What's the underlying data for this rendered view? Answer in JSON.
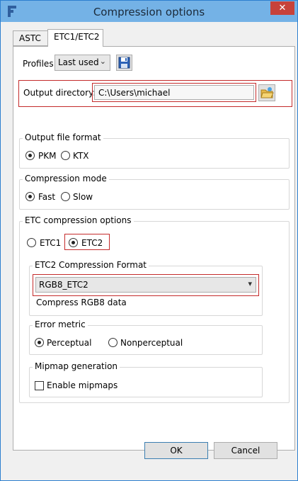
{
  "window": {
    "title": "Compression options",
    "close_glyph": "✕"
  },
  "tabs": [
    {
      "label": "ASTC"
    },
    {
      "label": "ETC1/ETC2"
    }
  ],
  "profiles": {
    "label": "Profiles",
    "selected": "Last used",
    "save_icon": "floppy-disk-icon"
  },
  "output": {
    "label": "Output directory:",
    "value": "C:\\Users\\michael",
    "browse_icon": "folder-open-icon"
  },
  "file_format": {
    "title": "Output file format",
    "options": [
      {
        "label": "PKM",
        "selected": true
      },
      {
        "label": "KTX",
        "selected": false
      }
    ]
  },
  "compression_mode": {
    "title": "Compression mode",
    "options": [
      {
        "label": "Fast",
        "selected": true
      },
      {
        "label": "Slow",
        "selected": false
      }
    ]
  },
  "etc_options": {
    "title": "ETC compression options",
    "codecs": [
      {
        "label": "ETC1",
        "selected": false
      },
      {
        "label": "ETC2",
        "selected": true
      }
    ],
    "etc2_format": {
      "title": "ETC2 Compression Format",
      "selected": "RGB8_ETC2",
      "description": "Compress RGB8 data"
    },
    "error_metric": {
      "title": "Error metric",
      "options": [
        {
          "label": "Perceptual",
          "selected": true
        },
        {
          "label": "Nonperceptual",
          "selected": false
        }
      ]
    },
    "mipmap": {
      "title": "Mipmap generation",
      "checkbox_label": "Enable mipmaps",
      "checked": false
    }
  },
  "buttons": {
    "ok": "OK",
    "cancel": "Cancel"
  },
  "colors": {
    "titlebar": "#74b2e6",
    "close": "#c7423a",
    "highlight": "#c42b2b"
  }
}
